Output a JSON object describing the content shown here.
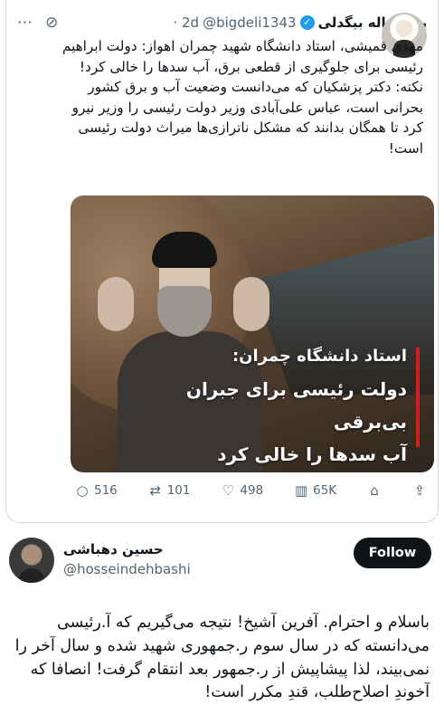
{
  "quoted_tweet": {
    "display_name": "رحمت‌اله بیگدلی",
    "handle": "@bigdeli1343",
    "time": "· 2d",
    "text": "مهدی قمیشی، استاد دانشگاه شهید چمران اهواز: دولت ابراهیم رئیسی برای جلوگیری از قطعی برق، آب سدها را خالی کرد!\nنکته: دکتر پزشکیان که می‌دانست وضعیت آب و برق کشور بحرانی است، عباس علی‌آبادی وزیر دولت رئیسی را وزیر نیرو کرد تا همگان بدانند که مشکل ناترازی‌ها میراث دولت رئیسی است!",
    "image_headline": {
      "line1": "استاد دانشگاه چمران:",
      "line2": "دولت رئیسی برای جبران بی‌برقی",
      "line3": "آب سدها را خالی کرد"
    },
    "stats": {
      "replies": "516",
      "retweets": "101",
      "likes": "498",
      "views": "65K"
    },
    "icons": {
      "grok": "grok-icon",
      "more": "more-icon",
      "reply": "reply-icon",
      "retweet": "retweet-icon",
      "like": "heart-icon",
      "views": "views-icon",
      "bookmark": "bookmark-icon",
      "share": "share-icon"
    }
  },
  "post": {
    "display_name": "حسین دهباشی",
    "handle": "@hosseindehbashi",
    "follow_label": "Follow",
    "text": "باسلام و احترام. آفرین آشیخ! نتیجه می‌گیریم که آ.رئیسی می‌دانسته که در سال سوم ر.جمهوری شهید شده و سال آخر را نمی‌بیند، لذا پیشاپیش از ر.جمهور بعد انتقام گرفت! انصافا که آخوندِ اصلاح‌طلب، قندِ مکرر است!"
  },
  "colors": {
    "text": "#0f1419",
    "muted": "#536471",
    "border": "#cfd9de",
    "verified": "#1d9bf0",
    "accent_bar": "#d11f1f"
  }
}
